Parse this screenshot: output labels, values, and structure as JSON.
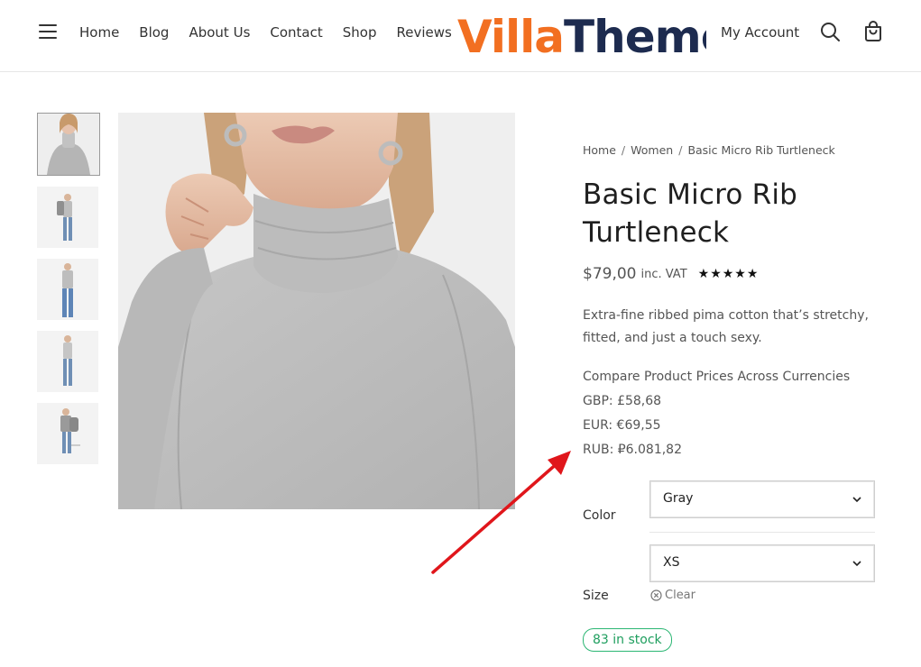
{
  "header": {
    "nav": [
      "Home",
      "Blog",
      "About Us",
      "Contact",
      "Shop",
      "Reviews"
    ],
    "brand": "VillaTheme",
    "account": "My Account"
  },
  "breadcrumb": [
    "Home",
    "Women",
    "Basic Micro Rib Turtleneck"
  ],
  "product": {
    "title_line1": "Basic Micro Rib",
    "title_line2": "Turtleneck",
    "price": "$79,00",
    "vat": "inc. VAT",
    "rating_stars": 5,
    "description_line1": "Extra-fine ribbed pima cotton that’s stretchy,",
    "description_line2": "fitted, and just a touch sexy.",
    "compare_heading": "Compare Product Prices Across Currencies",
    "currencies": [
      "GBP: £58,68",
      "EUR: €69,55",
      "RUB: ₽6.081,82"
    ],
    "color_label": "Color",
    "color_value": "Gray",
    "size_label": "Size",
    "size_value": "XS",
    "clear_label": "Clear",
    "stock": "83 in stock"
  },
  "colors": {
    "accent_logo": "#f26f21",
    "logo_dark": "#1d2b4f",
    "stock_green": "#2bb673",
    "arrow_red": "#e0161b"
  }
}
